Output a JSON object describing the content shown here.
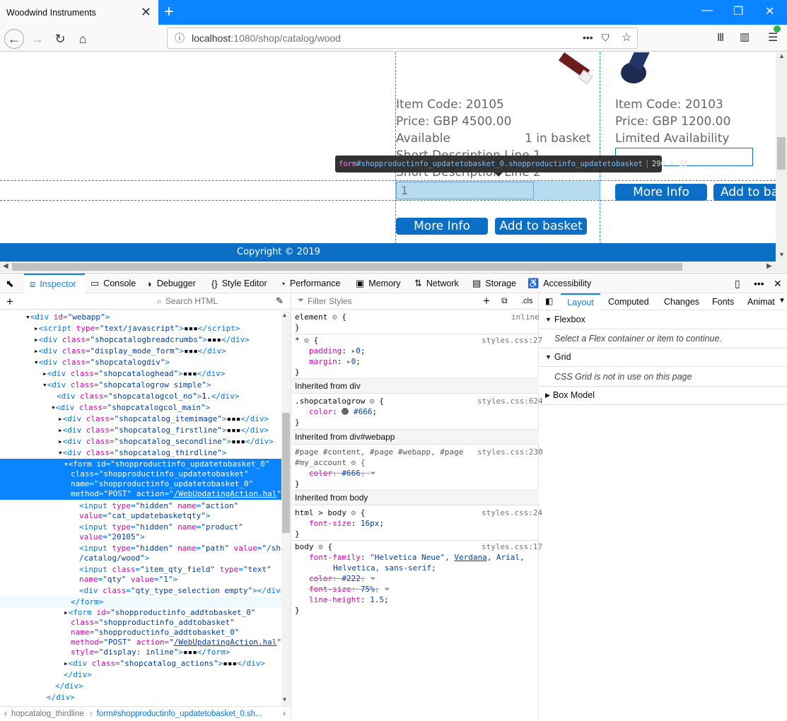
{
  "browser": {
    "tab_title": "Woodwind Instruments",
    "tab_close": "✕",
    "new_tab": "+",
    "url_prefix": "localhost",
    "url_rest": ":1080/shop/catalog/wood",
    "url_more": "•••"
  },
  "page": {
    "left_item": {
      "item_code": "Item Code: 20105",
      "price": "Price: GBP 4500.00",
      "availability": "Available",
      "in_basket": "1 in basket",
      "desc1": "Short Description Line 1",
      "desc2": "Short Description Line 2",
      "qty_value": "1",
      "more_info": "More Info",
      "add_to_basket": "Add to basket"
    },
    "right_item": {
      "item_code": "Item Code: 20103",
      "price": "Price: GBP 1200.00",
      "availability": "Limited Availability",
      "more_info": "More Info",
      "add_to_basket": "Add to ba"
    },
    "footer": "Copyright © 2019",
    "tooltip": {
      "tag": "form",
      "selector": "#shopproductinfo_updatetobasket_0.shopproductinfo_updatetobasket",
      "size": "290 × 28"
    }
  },
  "devtools": {
    "tabs": [
      "Inspector",
      "Console",
      "Debugger",
      "Style Editor",
      "Performance",
      "Memory",
      "Network",
      "Storage",
      "Accessibility"
    ],
    "search_html_placeholder": "Search HTML",
    "filter_styles_placeholder": "Filter Styles",
    "cls_label": ".cls",
    "breadcrumbs": [
      "hopcatalog_thirdline",
      "form#shopproductinfo_updatetobasket_0.sh..."
    ],
    "right_tabs": [
      "Layout",
      "Computed",
      "Changes",
      "Fonts",
      "Animat"
    ],
    "layout": {
      "flexbox": "Flexbox",
      "flexbox_note": "Select a Flex container or item to continue.",
      "grid": "Grid",
      "grid_note": "CSS Grid is not in use on this page",
      "box_model": "Box Model"
    },
    "styles": {
      "element_sel": "element",
      "element_src": "inline",
      "star_src": "styles.css:27",
      "star_padding": "0",
      "star_margin": "0",
      "inherited_div": "Inherited from div",
      "scg_sel": ".shopcatalogrow",
      "scg_src": "styles.css:624",
      "scg_color": "#666",
      "inherited_webapp": "Inherited from div#webapp",
      "page_sel1": "#page #content, #page #webapp, #page",
      "page_sel2": "#my_account",
      "page_src": "styles.css:230",
      "page_color": "#666",
      "inherited_body": "Inherited from body",
      "hb_sel": "html > body",
      "hb_src": "styles.css:24",
      "hb_fontsize": "16px",
      "body_sel": "body",
      "body_src": "styles.css:17",
      "body_ff1": "\"Helvetica Neue\",",
      "body_ff_link": "Verdana",
      "body_ff2": ", Arial,",
      "body_ff3": "Helvetica, sans-serif;",
      "body_color": "#222",
      "body_fontsize": "75%",
      "body_lh": "1.5"
    }
  }
}
